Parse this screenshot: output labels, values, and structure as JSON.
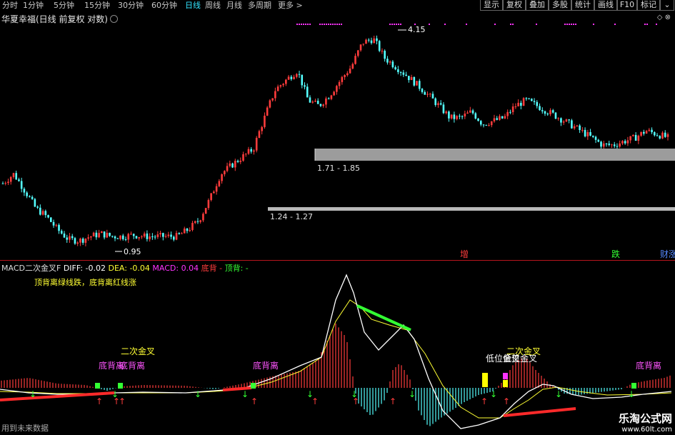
{
  "topbar": {
    "periods": [
      "分时",
      "1分钟",
      "5分钟",
      "15分钟",
      "30分钟",
      "60分钟",
      "日线",
      "周线",
      "月线",
      "多周期",
      "更多 >"
    ],
    "active_index": 6,
    "right_buttons": [
      "显示",
      "复权",
      "叠加",
      "多股",
      "统计",
      "画线",
      "F10",
      "标记"
    ]
  },
  "title": {
    "stock": "华夏幸福(日线 前复权 对数)"
  },
  "price": {
    "high_label": "4.15",
    "low_label": "0.95",
    "zone1_label": "1.71 - 1.85",
    "zone2_label": "1.24 - 1.27",
    "tag_zeng": "增",
    "tag_die": "跌",
    "tag_cai": "财涨"
  },
  "macd": {
    "name": "MACD二次金叉F",
    "diff": "DIFF: -0.02",
    "dea": "DEA: -0.04",
    "macd": "MACD: 0.04",
    "dibei": "底背",
    "dash": "-",
    "dingbei": "顶背:",
    "dingbei_val": "-",
    "note": "顶背离绿线跌，底背离红线涨",
    "label_erci": "二次金叉",
    "label_dbl1": "底背离",
    "label_dbl2": "底背离",
    "label_dbl3": "底背离",
    "label_dbl4": "底背离",
    "label_dwjc1": "低位金叉",
    "label_dwjc2": "低位金叉",
    "label_erci2": "二次金叉"
  },
  "footer": {
    "text": "用到未来数据"
  },
  "watermark": {
    "line1": "乐淘公式网",
    "line2": "www.60lt.com"
  },
  "colors": {
    "up": "#ff3c3c",
    "down": "#54ffff",
    "diff": "#ffffff",
    "dea": "#ffff33",
    "macd": "#ff33ff",
    "active": "#33e5ff"
  },
  "chart_data": {
    "type": "candlestick",
    "scale": "log",
    "price_path": [
      1.45,
      1.55,
      1.38,
      1.22,
      1.15,
      1.05,
      0.98,
      0.97,
      1.0,
      1.02,
      1.0,
      1.0,
      1.01,
      1.0,
      1.0,
      1.0,
      1.0,
      1.05,
      1.12,
      1.3,
      1.55,
      1.65,
      1.75,
      1.85,
      2.3,
      2.8,
      3.0,
      3.2,
      2.6,
      2.5,
      2.7,
      3.0,
      3.3,
      3.9,
      4.0,
      3.5,
      3.3,
      3.1,
      2.9,
      2.7,
      2.5,
      2.3,
      2.3,
      2.4,
      2.2,
      2.25,
      2.3,
      2.5,
      2.6,
      2.5,
      2.4,
      2.3,
      2.2,
      2.1,
      2.0,
      1.9,
      1.9,
      1.95,
      2.0,
      2.1,
      2.05,
      2.0
    ]
  }
}
